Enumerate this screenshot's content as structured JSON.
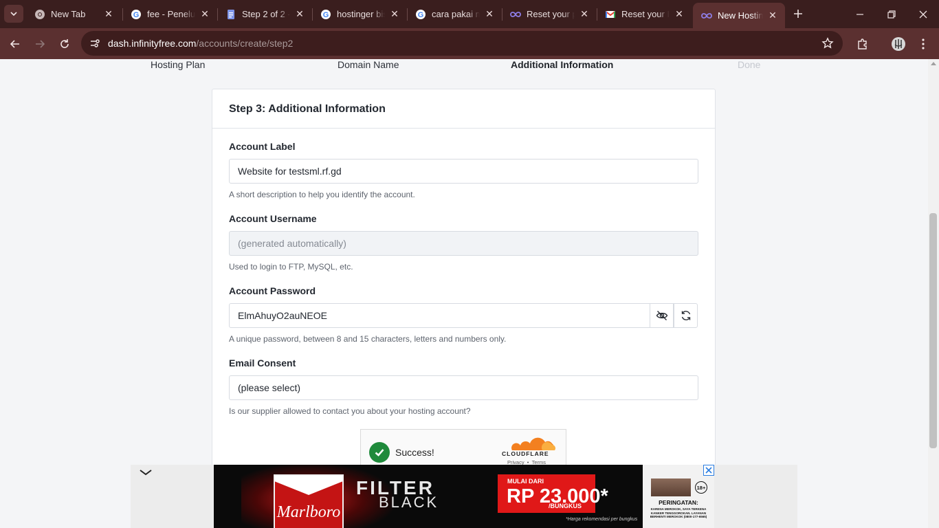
{
  "browser": {
    "tabs": [
      {
        "title": "New Tab",
        "icon": "chrome-icon"
      },
      {
        "title": "fee - Penelusuran Google",
        "icon": "google-icon"
      },
      {
        "title": "Step 2 of 2 - ",
        "icon": "forms-icon"
      },
      {
        "title": "hostinger bisnis",
        "icon": "google-icon"
      },
      {
        "title": "cara pakai m",
        "icon": "google-icon"
      },
      {
        "title": "Reset your p",
        "icon": "infinity-icon"
      },
      {
        "title": "Reset your In",
        "icon": "gmail-icon"
      },
      {
        "title": "New Hosting",
        "icon": "infinity-icon",
        "active": true
      }
    ],
    "url_host": "dash.infinityfree.com",
    "url_path": "/accounts/create/step2"
  },
  "steps": [
    {
      "label": "Hosting Plan",
      "state": "complete"
    },
    {
      "label": "Domain Name",
      "state": "complete"
    },
    {
      "label": "Additional Information",
      "state": "active"
    },
    {
      "label": "Done",
      "state": "disabled"
    }
  ],
  "form": {
    "title": "Step 3: Additional Information",
    "account_label": {
      "label": "Account Label",
      "value": "Website for testsml.rf.gd",
      "help": "A short description to help you identify the account."
    },
    "account_username": {
      "label": "Account Username",
      "placeholder": "(generated automatically)",
      "help": "Used to login to FTP, MySQL, etc."
    },
    "account_password": {
      "label": "Account Password",
      "value": "ElmAhuyO2auNEOE",
      "help": "A unique password, between 8 and 15 characters, letters and numbers only."
    },
    "email_consent": {
      "label": "Email Consent",
      "value": "(please select)",
      "help": "Is our supplier allowed to contact you about your hosting account?"
    }
  },
  "captcha": {
    "status": "Success!",
    "brand": "CLOUDFLARE",
    "privacy": "Privacy",
    "separator": "•",
    "terms": "Terms"
  },
  "ad": {
    "brand": "Marlboro",
    "product_line1": "FILTER",
    "product_line2": "BLACK",
    "price_prefix": "MULAI DARI",
    "price": "RP 23.000*",
    "price_unit": "/BUNGKUS",
    "footnote": "*Harga rekomendasi per bungkus",
    "age": "18+",
    "warning_title": "PERINGATAN:",
    "warning_text": "KARENA MEROKOK, SAYA TERKENA KANKER TENGGOROKAN. LAYANAN BERHENTI MEROKOK (0800-177-6565)"
  },
  "colors": {
    "tab_bar": "#3a1e1e",
    "toolbar": "#5b3030",
    "success_green": "#1f8a3b",
    "cloudflare_orange": "#f38020",
    "ad_red": "#e01818"
  }
}
